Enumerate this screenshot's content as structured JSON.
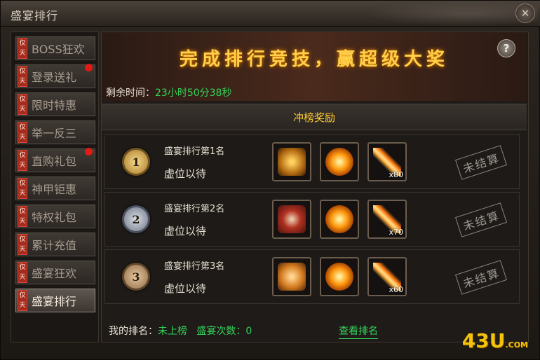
{
  "window": {
    "title": "盛宴排行"
  },
  "sidebar": {
    "tag_text": [
      "仅",
      "天"
    ],
    "items": [
      {
        "label": "BOSS狂欢",
        "dot": false
      },
      {
        "label": "登录送礼",
        "dot": true
      },
      {
        "label": "限时特惠",
        "dot": false
      },
      {
        "label": "举一反三",
        "dot": false
      },
      {
        "label": "直购礼包",
        "dot": true
      },
      {
        "label": "神甲钜惠",
        "dot": false
      },
      {
        "label": "特权礼包",
        "dot": false
      },
      {
        "label": "累计充值",
        "dot": false
      },
      {
        "label": "盛宴狂欢",
        "dot": false
      },
      {
        "label": "盛宴排行",
        "dot": false,
        "active": true
      }
    ]
  },
  "banner": {
    "title": "完成排行竞技，赢超级大奖",
    "help_icon": "?"
  },
  "timer": {
    "label": "剩余时间：",
    "value": "23小时50分38秒"
  },
  "section": {
    "header": "冲榜奖励"
  },
  "ranks": [
    {
      "medal": "1",
      "title": "盛宴排行第1名",
      "holder": "虚位以待",
      "status": "未结算",
      "items": [
        {
          "icon": "gold-chest-icon",
          "qty": ""
        },
        {
          "icon": "fire-orb-icon",
          "qty": ""
        },
        {
          "icon": "flame-blade-icon",
          "qty": "x80"
        }
      ]
    },
    {
      "medal": "2",
      "title": "盛宴排行第2名",
      "holder": "虚位以待",
      "status": "未结算",
      "items": [
        {
          "icon": "red-chest-icon",
          "qty": ""
        },
        {
          "icon": "fire-orb-icon",
          "qty": ""
        },
        {
          "icon": "flame-blade-icon",
          "qty": "x70"
        }
      ]
    },
    {
      "medal": "3",
      "title": "盛宴排行第3名",
      "holder": "虚位以待",
      "status": "未结算",
      "items": [
        {
          "icon": "orange-chest-icon",
          "qty": ""
        },
        {
          "icon": "fire-orb-icon",
          "qty": ""
        },
        {
          "icon": "flame-blade-icon",
          "qty": "x60"
        }
      ]
    }
  ],
  "footer": {
    "my_rank_label": "我的排名：",
    "my_rank_value": "未上榜",
    "count_label": "盛宴次数：",
    "count_value": "0",
    "view_link": "查看排名"
  },
  "watermark": {
    "text": "43U",
    "suffix": ".COM"
  },
  "colors": {
    "accent_green": "#33d35a",
    "accent_gold": "#ffcc33",
    "tag_red": "#a62a1e"
  }
}
